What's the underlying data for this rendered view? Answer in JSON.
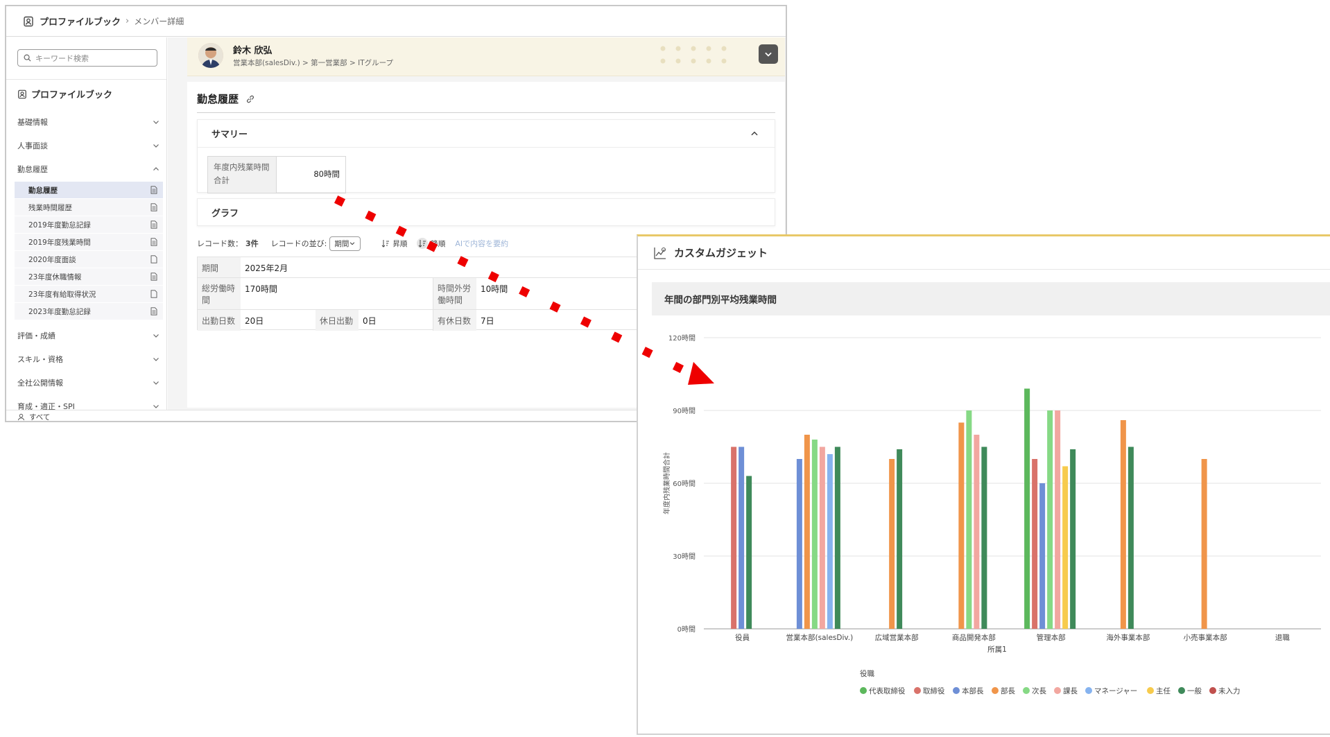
{
  "topbar": {
    "app_title": "プロファイルブック",
    "breadcrumb_sub": "メンバー詳細"
  },
  "sidebar": {
    "search_placeholder": "キーワード検索",
    "title": "プロファイルブック",
    "sections": [
      {
        "label": "基礎情報",
        "expanded": false
      },
      {
        "label": "人事面談",
        "expanded": false
      },
      {
        "label": "勤怠履歴",
        "expanded": true
      },
      {
        "label": "評価・成績",
        "expanded": false
      },
      {
        "label": "スキル・資格",
        "expanded": false
      },
      {
        "label": "全社公開情報",
        "expanded": false
      },
      {
        "label": "育成・適正・SPI",
        "expanded": false
      }
    ],
    "sub_items": [
      {
        "label": "勤怠履歴",
        "active": true
      },
      {
        "label": "残業時間履歴"
      },
      {
        "label": "2019年度勤怠記録"
      },
      {
        "label": "2019年度残業時間"
      },
      {
        "label": "2020年度面談"
      },
      {
        "label": "23年度休職情報"
      },
      {
        "label": "23年度有給取得状況"
      },
      {
        "label": "2023年度勤怠記録"
      }
    ],
    "bottom_label": "すべて"
  },
  "profile": {
    "name": "鈴木 欣弘",
    "org": "営業本部(salesDiv.) > 第一営業部 > ITグループ"
  },
  "card": {
    "title": "勤怠履歴",
    "summary": {
      "heading": "サマリー",
      "label": "年度内残業時間合計",
      "value": "80時間"
    },
    "graph_heading": "グラフ",
    "record_bar": {
      "count_label": "レコード数：",
      "count": "3件",
      "sort_label": "レコードの並び:",
      "sort_value": "期間",
      "asc": "昇順",
      "desc": "降順",
      "ai_link": "AIで内容を要約"
    },
    "records": {
      "period_label": "期間",
      "period_value": "2025年2月",
      "total_label": "総労働時間",
      "total_value": "170時間",
      "overtime_label": "時間外労働時間",
      "overtime_value": "10時間",
      "attend_label": "出勤日数",
      "attend_value": "20日",
      "holiday_label": "休日出勤",
      "holiday_value": "0日",
      "paid_label": "有休日数",
      "paid_value": "7日"
    }
  },
  "gadget": {
    "title": "カスタムガジェット"
  },
  "chart_data": {
    "type": "bar",
    "title": "年間の部門別平均残業時間",
    "xlabel": "所属1",
    "ylabel": "年度内残業時間合計",
    "ylim": [
      0,
      120
    ],
    "yticks": [
      "0時間",
      "30時間",
      "60時間",
      "90時間",
      "120時間"
    ],
    "grid": true,
    "legend_position": "bottom",
    "legend_title": "役職",
    "categories": [
      "役員",
      "営業本部(salesDiv.)",
      "広域営業本部",
      "商品開発本部",
      "管理本部",
      "海外事業本部",
      "小売事業本部",
      "退職"
    ],
    "series": [
      {
        "name": "代表取締役",
        "color": "#5cb85c",
        "values": [
          null,
          null,
          null,
          null,
          99,
          null,
          null,
          null
        ]
      },
      {
        "name": "取締役",
        "color": "#d9726a",
        "values": [
          75,
          null,
          null,
          null,
          70,
          null,
          null,
          null
        ]
      },
      {
        "name": "本部長",
        "color": "#6e8fd6",
        "values": [
          75,
          70,
          null,
          null,
          60,
          null,
          null,
          null
        ]
      },
      {
        "name": "部長",
        "color": "#f0954a",
        "values": [
          null,
          80,
          70,
          85,
          null,
          86,
          70,
          null
        ]
      },
      {
        "name": "次長",
        "color": "#86d985",
        "values": [
          null,
          78,
          null,
          90,
          90,
          null,
          null,
          null
        ]
      },
      {
        "name": "課長",
        "color": "#f2a7a0",
        "values": [
          null,
          75,
          null,
          80,
          90,
          null,
          null,
          null
        ]
      },
      {
        "name": "マネージャー",
        "color": "#86b3ef",
        "values": [
          null,
          72,
          null,
          null,
          null,
          null,
          null,
          null
        ]
      },
      {
        "name": "主任",
        "color": "#f7cb4d",
        "values": [
          null,
          null,
          null,
          null,
          67,
          null,
          null,
          null
        ]
      },
      {
        "name": "一般",
        "color": "#3f8a5a",
        "values": [
          63,
          75,
          74,
          75,
          74,
          75,
          null,
          null
        ]
      },
      {
        "name": "未入力",
        "color": "#c0504d",
        "values": [
          null,
          null,
          null,
          null,
          null,
          null,
          null,
          null
        ]
      }
    ]
  }
}
